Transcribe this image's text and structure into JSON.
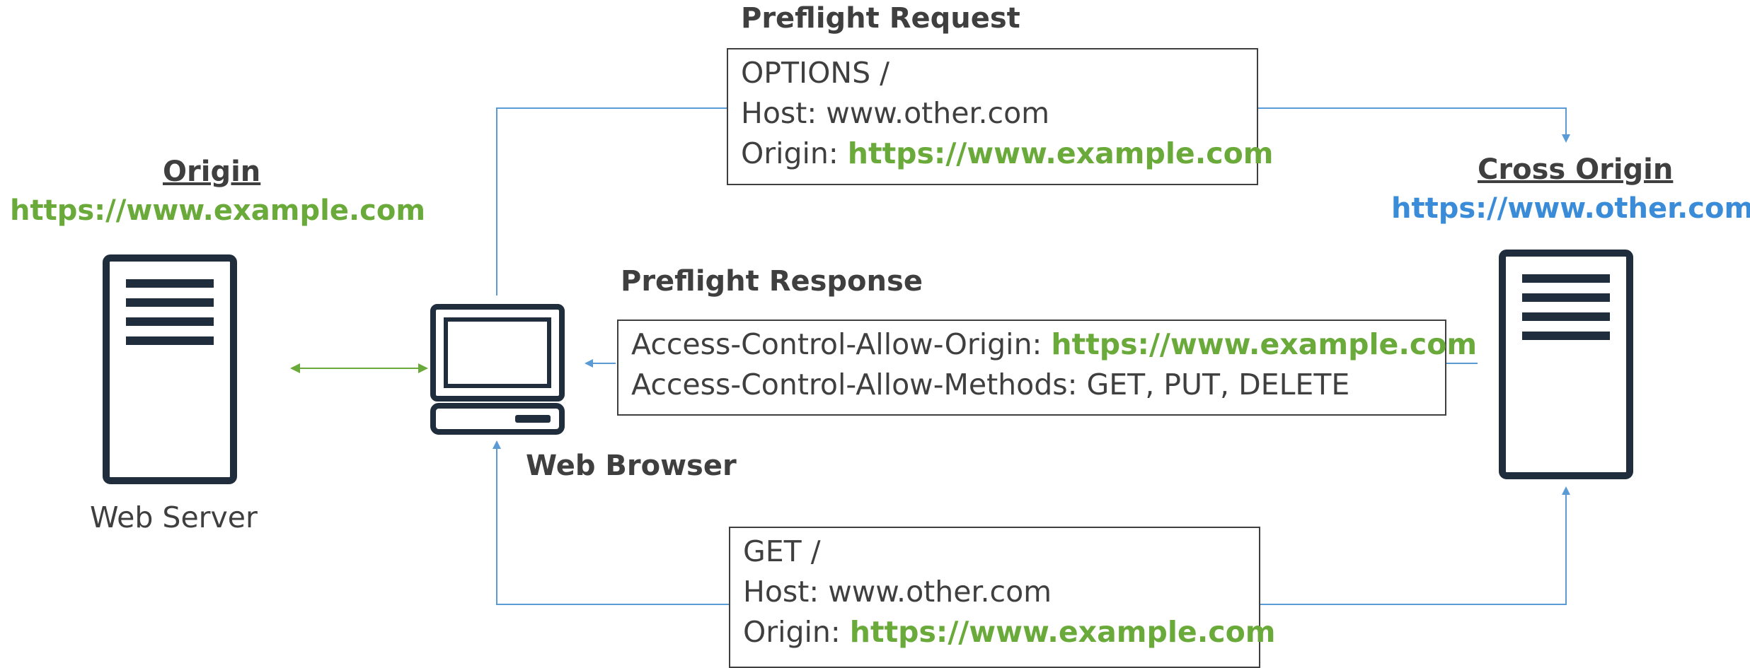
{
  "origin": {
    "title": "Origin",
    "url": "https://www.example.com",
    "server_label": "Web Server"
  },
  "cross_origin": {
    "title": "Cross Origin",
    "url": "https://www.other.com"
  },
  "browser": {
    "label": "Web Browser"
  },
  "preflight_request": {
    "title": "Preflight Request",
    "line1": "OPTIONS /",
    "line2": "Host: www.other.com",
    "line3_prefix": "Origin: ",
    "line3_value": "https://www.example.com"
  },
  "preflight_response": {
    "title": "Preflight Response",
    "line1_prefix": "Access-Control-Allow-Origin: ",
    "line1_value": "https://www.example.com",
    "line2": "Access-Control-Allow-Methods: GET, PUT, DELETE"
  },
  "get_request": {
    "line1": "GET /",
    "line2": "Host: www.other.com",
    "line3_prefix": "Origin: ",
    "line3_value": "https://www.example.com"
  },
  "colors": {
    "accent_green": "#6aaa3a",
    "accent_blue": "#3a8cd8",
    "connector_blue": "#5b9bd5",
    "icon_dark": "#1f2d3d",
    "text": "#3f3f3f"
  },
  "icons": [
    "server-icon",
    "laptop-icon"
  ]
}
